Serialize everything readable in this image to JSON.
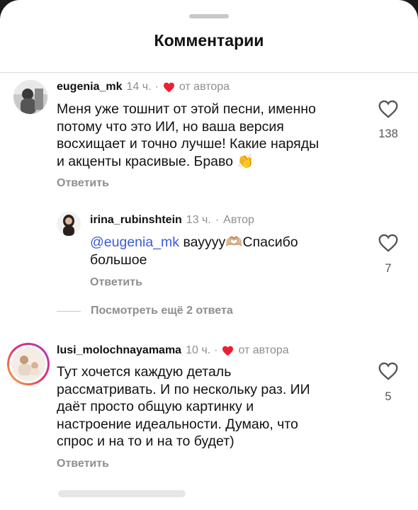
{
  "sheet": {
    "title": "Комментарии"
  },
  "comments": [
    {
      "username": "eugenia_mk",
      "time": "14 ч.",
      "sep": "·",
      "badge": "от автора",
      "lines": [
        "Меня уже тошнит от этой песни, именно",
        "потому что это ИИ, но ваша версия",
        "восхищает и точно лучше! Какие наряды",
        "и акценты красивые. Браво 👏"
      ],
      "reply_label": "Ответить",
      "likes": "138"
    },
    {
      "username": "irina_rubinshtein",
      "time": "13 ч.",
      "sep": "·",
      "badge": "Автор",
      "mention": "@eugenia_mk",
      "line1_rest": " вауууу🫶🏼Спасибо",
      "line2": "большое",
      "reply_label": "Ответить",
      "likes": "7"
    },
    {
      "username": "lusi_molochnayamama",
      "time": "10 ч.",
      "sep": "·",
      "badge": "от автора",
      "lines": [
        "Тут хочется каждую деталь",
        "рассматривать. И по нескольку раз. ИИ",
        "даёт просто общую картинку и",
        "настроение идеальности. Думаю,  что",
        "спрос и на то и на то будет)"
      ],
      "reply_label": "Ответить",
      "likes": "5"
    }
  ],
  "view_more_replies": "Посмотреть ещё 2 ответа",
  "colors": {
    "heart_red": "#ed1f33",
    "meta_gray": "#8e8e8e",
    "mention_blue": "#3b5bdb"
  }
}
